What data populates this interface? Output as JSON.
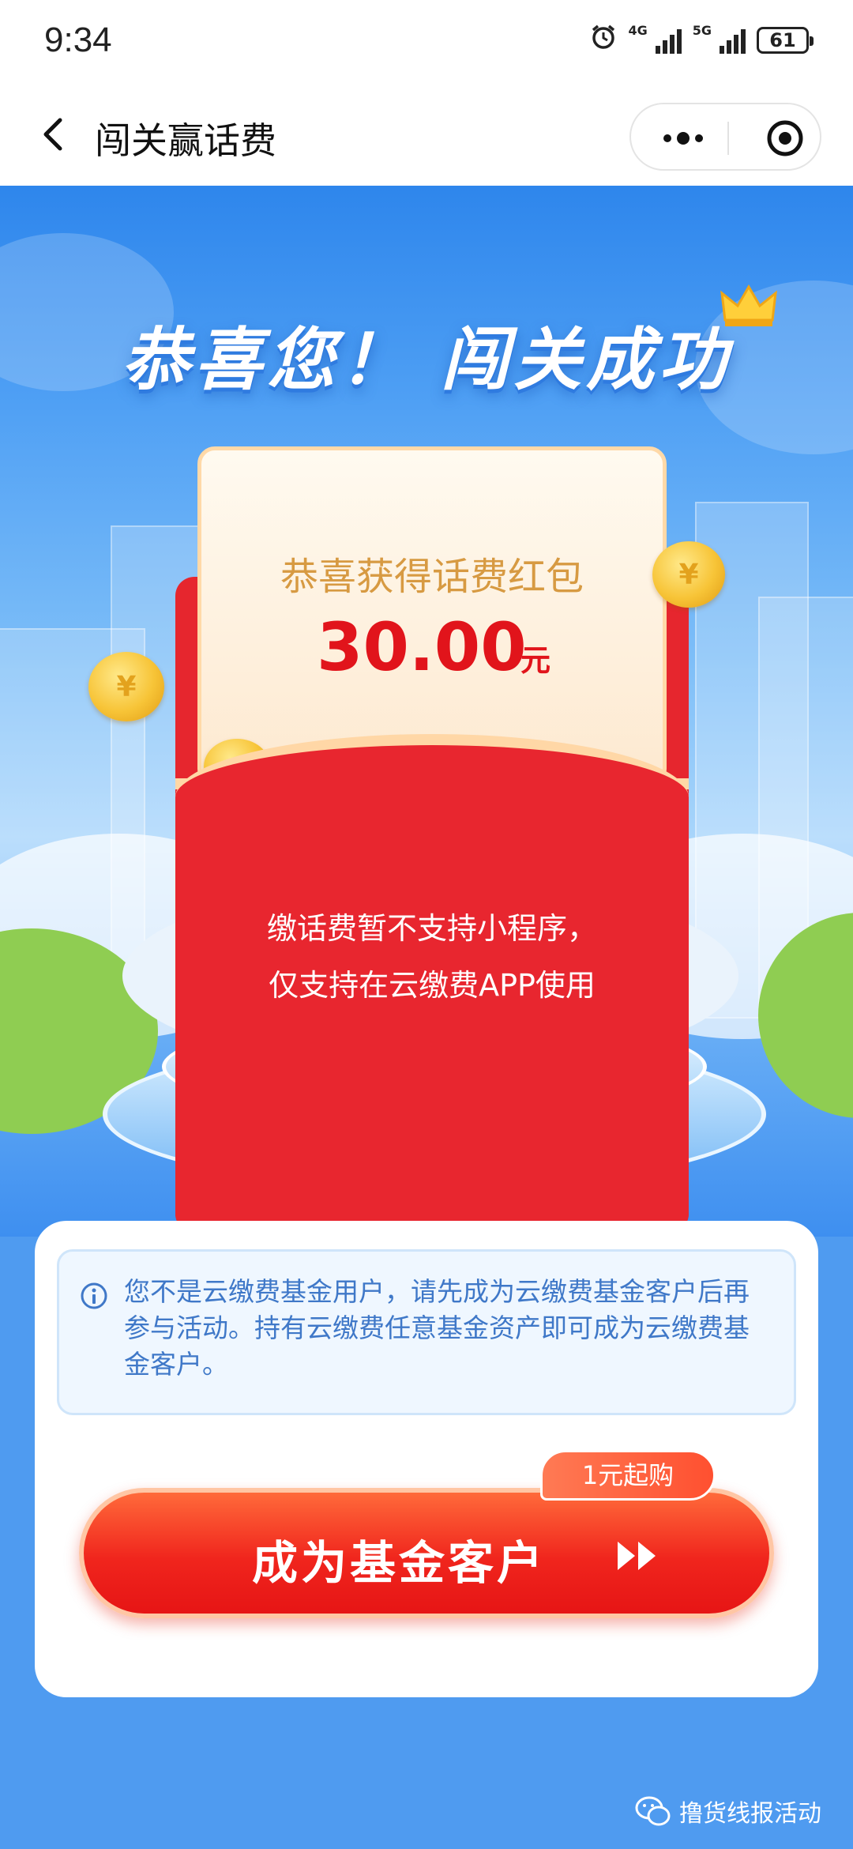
{
  "status_bar": {
    "time": "9:34",
    "network_1": "4G",
    "network_2": "5G",
    "battery": "61"
  },
  "nav": {
    "title": "闯关赢话费"
  },
  "hero": {
    "headline": "恭喜您！ 闯关成功",
    "card_title": "恭喜获得话费红包",
    "amount": "30.00",
    "amount_unit": "元",
    "envelope_line1": "缴话费暂不支持小程序，",
    "envelope_line2": "仅支持在云缴费APP使用"
  },
  "panel": {
    "notice_text": "您不是云缴费基金用户，请先成为云缴费基金客户后再参与活动。持有云缴费任意基金资产即可成为云缴费基金客户。",
    "cta_label": "成为基金客户",
    "cta_tag": "1元起购"
  },
  "watermark": {
    "text": "撸货线报活动"
  },
  "colors": {
    "accent_red": "#e8262f",
    "sky_blue": "#4e9ff4",
    "gold_text": "#d79a42",
    "notice_blue": "#3f78c8"
  }
}
